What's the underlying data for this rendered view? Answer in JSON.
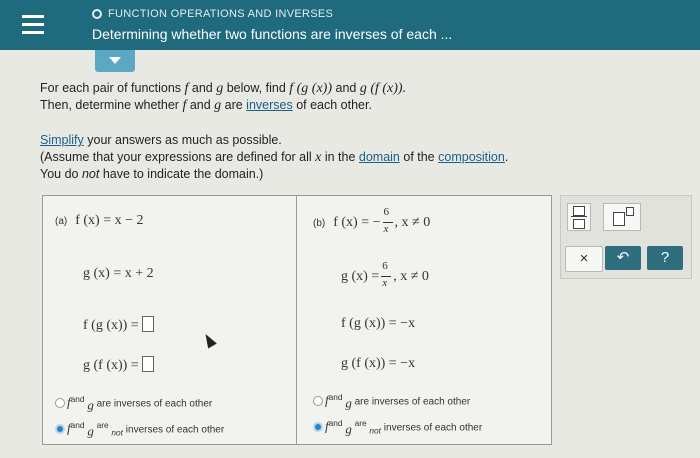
{
  "header": {
    "breadcrumb": "FUNCTION OPERATIONS AND INVERSES",
    "title": "Determining whether two functions are inverses of each ..."
  },
  "instructions": {
    "line1_a": "For each pair of functions ",
    "line1_f": "f",
    "line1_b": " and ",
    "line1_g": "g",
    "line1_c": " below, find ",
    "line1_fg": "f (g (x))",
    "line1_d": " and ",
    "line1_gf": "g (f (x)).",
    "line2_a": "Then, determine whether ",
    "line2_f": "f",
    "line2_b": " and ",
    "line2_g": "g",
    "line2_c": " are ",
    "inverses_link": "inverses",
    "line2_d": " of each other.",
    "simplify_link": "Simplify",
    "simplify_rest": " your answers as much as possible.",
    "assume_a": "(Assume that your expressions are defined for all ",
    "assume_x": "x",
    "assume_b": " in the ",
    "domain_link": "domain",
    "assume_c": " of the ",
    "composition_link": "composition",
    "assume_d": ".",
    "nodomain_a": "You do ",
    "nodomain_not": "not",
    "nodomain_b": " have to indicate the domain.)"
  },
  "part_a": {
    "label": "(a)",
    "f_def": "f (x) = x − 2",
    "g_def": "g (x) = x + 2",
    "fg_label": "f (g (x)) =",
    "gf_label": "g (f (x)) =",
    "opt1_f": "f",
    "opt1_and": "and",
    "opt1_g": "g",
    "opt1_text": "are inverses of each other",
    "opt2_f": "f",
    "opt2_and": "and",
    "opt2_g": "g",
    "opt2_are": "are",
    "opt2_not": "not",
    "opt2_text": "inverses of each other",
    "selected": "not_inverses"
  },
  "part_b": {
    "label": "(b)",
    "f_lhs": "f (x) = −",
    "f_num": "6",
    "f_den": "x",
    "f_cond": ", x ≠ 0",
    "g_lhs": "g (x) =",
    "g_num": "6",
    "g_den": "x",
    "g_cond": ", x ≠ 0",
    "fg_label": "f (g (x)) =",
    "fg_value": "−x",
    "gf_label": "g (f (x)) =",
    "gf_value": "−x",
    "opt1_f": "f",
    "opt1_and": "and",
    "opt1_g": "g",
    "opt1_text": "are inverses of each other",
    "opt2_f": "f",
    "opt2_and": "and",
    "opt2_g": "g",
    "opt2_are": "are",
    "opt2_not": "not",
    "opt2_text": "inverses of each other",
    "selected": "not_inverses"
  },
  "tools": {
    "clear": "×",
    "undo": "↶",
    "help": "?"
  },
  "colors": {
    "header_bg": "#1f6a7d",
    "link": "#1b5e8a",
    "radio_selected": "#2a83c4"
  }
}
